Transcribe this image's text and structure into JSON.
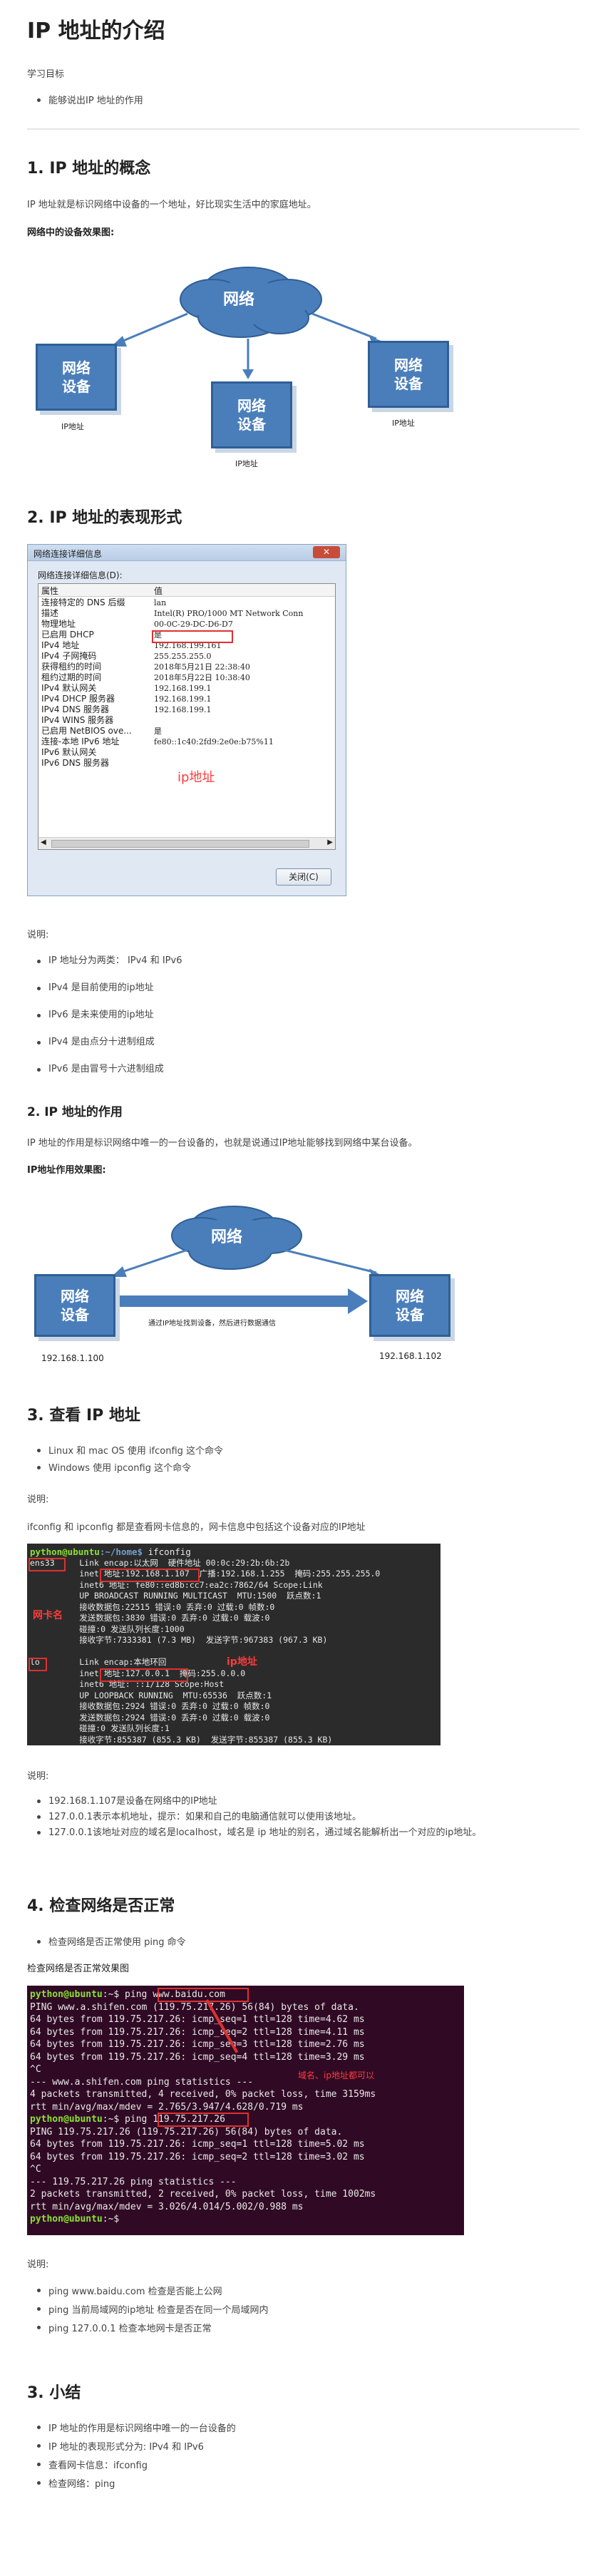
{
  "title": "IP 地址的介绍",
  "goals": {
    "heading": "学习目标",
    "items": [
      "能够说出IP 地址的作用"
    ]
  },
  "s1": {
    "heading": "1. IP 地址的概念",
    "p1": "IP 地址就是标识网络中设备的一个地址，好比现实生活中的家庭地址。",
    "p2": "网络中的设备效果图:",
    "diagram": {
      "cloud": "网络",
      "box": "网络\n设备",
      "box_label": "IP地址"
    }
  },
  "s2": {
    "heading": "2. IP 地址的表现形式",
    "dialog": {
      "title": "网络连接详细信息",
      "caption": "网络连接详细信息(D):",
      "col_prop": "属性",
      "col_val": "值",
      "rows": [
        [
          "连接特定的 DNS 后缀",
          "lan"
        ],
        [
          "描述",
          "Intel(R) PRO/1000 MT Network Conn"
        ],
        [
          "物理地址",
          "00-0C-29-DC-D6-D7"
        ],
        [
          "已启用 DHCP",
          "是"
        ],
        [
          "IPv4 地址",
          "192.168.199.161"
        ],
        [
          "IPv4 子网掩码",
          "255.255.255.0"
        ],
        [
          "获得租约的时间",
          "2018年5月21日 22:38:40"
        ],
        [
          "租约过期的时间",
          "2018年5月22日 10:38:40"
        ],
        [
          "IPv4 默认网关",
          "192.168.199.1"
        ],
        [
          "IPv4 DHCP 服务器",
          "192.168.199.1"
        ],
        [
          "IPv4 DNS 服务器",
          "192.168.199.1"
        ],
        [
          "IPv4 WINS 服务器",
          ""
        ],
        [
          "已启用 NetBIOS ove...",
          "是"
        ],
        [
          "连接-本地 IPv6 地址",
          "fe80::1c40:2fd9:2e0e:b75%11"
        ],
        [
          "IPv6 默认网关",
          ""
        ],
        [
          "IPv6 DNS 服务器",
          ""
        ]
      ],
      "annotation": "ip地址",
      "close_button": "关闭(C)"
    },
    "note_label": "说明:",
    "notes": [
      "IP 地址分为两类： IPv4 和 IPv6",
      "IPv4 是目前使用的ip地址",
      "IPv6 是未来使用的ip地址",
      "IPv4 是由点分十进制组成",
      "IPv6 是由冒号十六进制组成"
    ]
  },
  "s2b": {
    "heading": "2. IP 地址的作用",
    "p1": "IP 地址的作用是标识网络中唯一的一台设备的，也就是说通过IP地址能够找到网络中某台设备。",
    "p2": "IP地址作用效果图:",
    "diagram": {
      "cloud": "网络",
      "box": "网络\n设备",
      "left_ip": "192.168.1.100",
      "right_ip": "192.168.1.102",
      "arrow_text": "通过IP地址找到设备，然后进行数据通信"
    }
  },
  "s3": {
    "heading": "3. 查看 IP 地址",
    "items": [
      "Linux 和 mac OS 使用 ifconfig 这个命令",
      "Windows 使用 ipconfig 这个命令"
    ],
    "note_label": "说明:",
    "p1": "ifconfig 和 ipconfig 都是查看网卡信息的，网卡信息中包括这个设备对应的IP地址",
    "terminal": {
      "prompt_user": "python@ubuntu",
      "prompt_path": ":~/home$",
      "command": " ifconfig",
      "lines": [
        "ens33     Link encap:以太网  硬件地址 00:0c:29:2b:6b:2b",
        "          inet 地址:192.168.1.107  广播:192.168.1.255  掩码:255.255.255.0",
        "          inet6 地址: fe80::ed8b:cc7:ea2c:7862/64 Scope:Link",
        "          UP BROADCAST RUNNING MULTICAST  MTU:1500  跃点数:1",
        "          接收数据包:22515 错误:0 丢弃:0 过载:0 帧数:0",
        "          发送数据包:3830 错误:0 丢弃:0 过载:0 载波:0",
        "          碰撞:0 发送队列长度:1000",
        "          接收字节:7333381 (7.3 MB)  发送字节:967383 (967.3 KB)",
        "",
        "lo        Link encap:本地环回",
        "          inet 地址:127.0.0.1  掩码:255.0.0.0",
        "          inet6 地址: ::1/128 Scope:Host",
        "          UP LOOPBACK RUNNING  MTU:65536  跃点数:1",
        "          接收数据包:2924 错误:0 丢弃:0 过载:0 帧数:0",
        "          发送数据包:2924 错误:0 丢弃:0 过载:0 载波:0",
        "          碰撞:0 发送队列长度:1",
        "          接收字节:855387 (855.3 KB)  发送字节:855387 (855.3 KB)"
      ],
      "annot_nic": "网卡名",
      "annot_ip": "ip地址"
    },
    "note2_label": "说明:",
    "notes": [
      "192.168.1.107是设备在网络中的IP地址",
      "127.0.0.1表示本机地址，提示：如果和自己的电脑通信就可以使用该地址。",
      "127.0.0.1该地址对应的域名是localhost，域名是 ip 地址的别名，通过域名能解析出一个对应的ip地址。"
    ]
  },
  "s4": {
    "heading": "4. 检查网络是否正常",
    "items": [
      "检查网络是否正常使用 ping 命令"
    ],
    "p1": "检查网络是否正常效果图",
    "terminal": {
      "lines": [
        [
          "python@ubuntu",
          ":~$ ping www.baidu.com"
        ],
        [
          "",
          "PING www.a.shifen.com (119.75.217.26) 56(84) bytes of data."
        ],
        [
          "",
          "64 bytes from 119.75.217.26: icmp_seq=1 ttl=128 time=4.62 ms"
        ],
        [
          "",
          "64 bytes from 119.75.217.26: icmp_seq=2 ttl=128 time=4.11 ms"
        ],
        [
          "",
          "64 bytes from 119.75.217.26: icmp_seq=3 ttl=128 time=2.76 ms"
        ],
        [
          "",
          "64 bytes from 119.75.217.26: icmp_seq=4 ttl=128 time=3.29 ms"
        ],
        [
          "",
          "^C"
        ],
        [
          "",
          "--- www.a.shifen.com ping statistics ---"
        ],
        [
          "",
          "4 packets transmitted, 4 received, 0% packet loss, time 3159ms"
        ],
        [
          "",
          "rtt min/avg/max/mdev = 2.765/3.947/4.628/0.719 ms"
        ],
        [
          "python@ubuntu",
          ":~$ ping 119.75.217.26"
        ],
        [
          "",
          "PING 119.75.217.26 (119.75.217.26) 56(84) bytes of data."
        ],
        [
          "",
          "64 bytes from 119.75.217.26: icmp_seq=1 ttl=128 time=5.02 ms"
        ],
        [
          "",
          "64 bytes from 119.75.217.26: icmp_seq=2 ttl=128 time=3.02 ms"
        ],
        [
          "",
          "^C"
        ],
        [
          "",
          "--- 119.75.217.26 ping statistics ---"
        ],
        [
          "",
          "2 packets transmitted, 2 received, 0% packet loss, time 1002ms"
        ],
        [
          "",
          "rtt min/avg/max/mdev = 3.026/4.014/5.002/0.988 ms"
        ],
        [
          "python@ubuntu",
          ":~$ "
        ]
      ],
      "annot": "域名、ip地址都可以"
    },
    "note_label": "说明:",
    "notes": [
      "ping www.baidu.com 检查是否能上公网",
      "ping 当前局域网的ip地址 检查是否在同一个局域网内",
      "ping 127.0.0.1 检查本地网卡是否正常"
    ]
  },
  "s5": {
    "heading": "3. 小结",
    "items": [
      "IP 地址的作用是标识网络中唯一的一台设备的",
      "IP 地址的表现形式分为: IPv4 和 IPv6",
      "查看网卡信息：ifconfig",
      "检查网络：ping"
    ]
  }
}
